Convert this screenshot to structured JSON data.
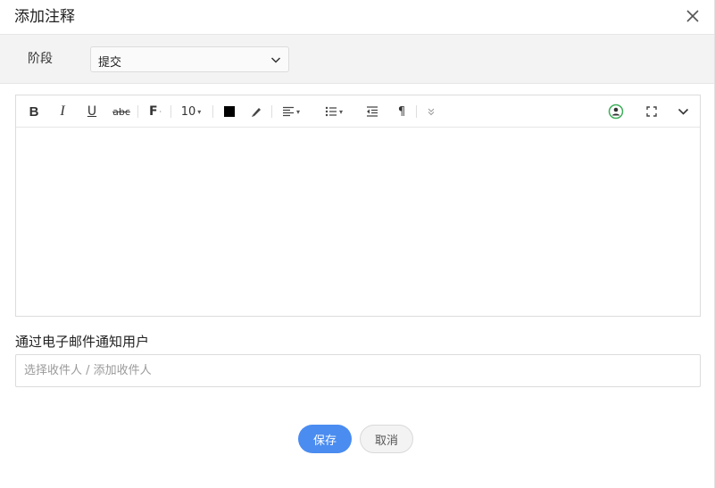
{
  "dialog": {
    "title": "添加注释",
    "close_icon": "close-icon"
  },
  "stage": {
    "label": "阶段",
    "selected": "提交"
  },
  "toolbar": {
    "font_size": "10",
    "text_color": "#000000",
    "icons": [
      "bold-icon",
      "italic-icon",
      "underline-icon",
      "strikethrough-icon",
      "font-family-icon",
      "font-size-select",
      "text-color-icon",
      "highlight-icon",
      "align-icon",
      "list-icon",
      "outdent-icon",
      "paragraph-icon",
      "more-icon",
      "mention-user-icon",
      "fullscreen-icon",
      "collapse-icon"
    ]
  },
  "notify": {
    "label": "通过电子邮件通知用户",
    "placeholder": "选择收件人 / 添加收件人"
  },
  "buttons": {
    "save": "保存",
    "cancel": "取消"
  },
  "colors": {
    "primary": "#4a8cf0",
    "mention_green": "#3fae5b"
  }
}
